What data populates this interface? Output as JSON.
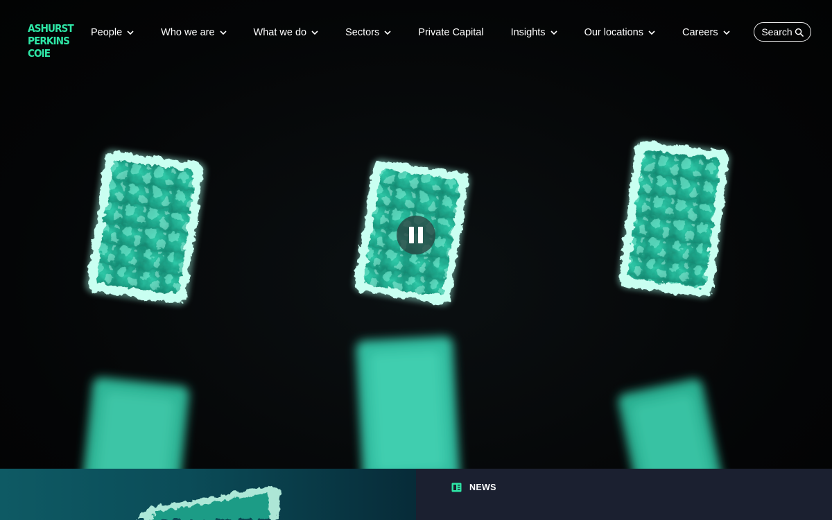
{
  "brand": {
    "logo_lines": [
      "ASHURST",
      "PERKINS",
      "COIE"
    ],
    "accent": "#2ee6a6"
  },
  "nav": {
    "items": [
      {
        "label": "People",
        "dropdown": true
      },
      {
        "label": "Who we are",
        "dropdown": true
      },
      {
        "label": "What we do",
        "dropdown": true
      },
      {
        "label": "Sectors",
        "dropdown": true
      },
      {
        "label": "Private Capital",
        "dropdown": false
      },
      {
        "label": "Insights",
        "dropdown": true
      },
      {
        "label": "Our locations",
        "dropdown": true
      },
      {
        "label": "Careers",
        "dropdown": true
      }
    ],
    "search_label": "Search",
    "search_icon": "magnifier-icon",
    "chevron_icon": "chevron-down-icon"
  },
  "hero": {
    "video_state": "playing",
    "control_icon": "pause-icon",
    "card_color": "#36d8b4"
  },
  "news": {
    "tag_label": "NEWS",
    "tag_icon": "newspaper-icon",
    "icon_color": "#2ee6a6"
  }
}
